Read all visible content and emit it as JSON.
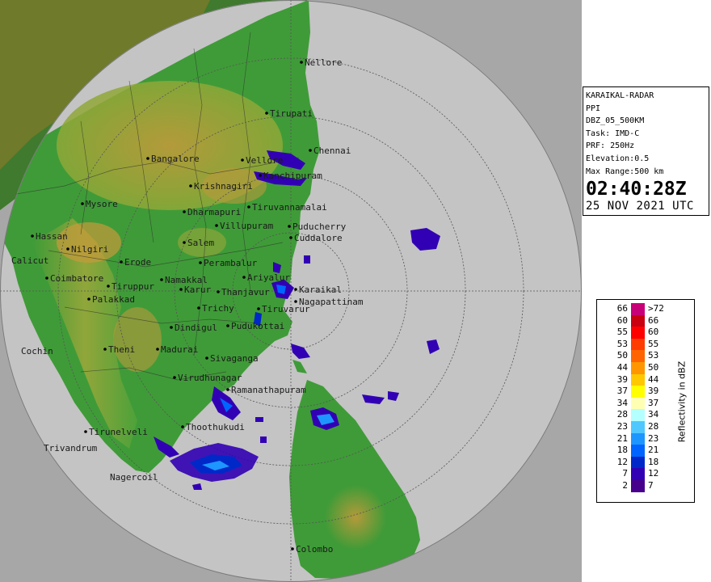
{
  "radar": {
    "station": "KARAIKAL-RADAR",
    "product": "PPI",
    "product_id": "DBZ_05_500KM",
    "task": "Task: IMD-C",
    "prf": "PRF: 250Hz",
    "elevation": "Elevation:0.5",
    "max_range": "Max Range:500 km",
    "time": "02:40:28Z",
    "date": "25 NOV 2021 UTC"
  },
  "colors": {
    "outside_range": "#a7a7a7",
    "sea": "#c4c4c4",
    "land_low": "#3f9b38",
    "land_mid": "#8ea838",
    "land_high": "#c89a3a",
    "grid": "#555555"
  },
  "cities": [
    {
      "name": "Nellore"
    },
    {
      "name": "Tirupati"
    },
    {
      "name": "Chennai"
    },
    {
      "name": "Bangalore"
    },
    {
      "name": "Vellore"
    },
    {
      "name": "Kanchipuram"
    },
    {
      "name": "Krishnagiri"
    },
    {
      "name": "Mysore"
    },
    {
      "name": "Tiruvannamalai"
    },
    {
      "name": "Dharmapuri"
    },
    {
      "name": "Villupuram"
    },
    {
      "name": "Puducherry"
    },
    {
      "name": "Cuddalore"
    },
    {
      "name": "Hassan"
    },
    {
      "name": "Nilgiri"
    },
    {
      "name": "Salem"
    },
    {
      "name": "Calicut"
    },
    {
      "name": "Erode"
    },
    {
      "name": "Perambalur"
    },
    {
      "name": "Ariyalur"
    },
    {
      "name": "Coimbatore"
    },
    {
      "name": "Tiruppur"
    },
    {
      "name": "Namakkal"
    },
    {
      "name": "Karur"
    },
    {
      "name": "Thanjavur"
    },
    {
      "name": "Karaikal"
    },
    {
      "name": "Nagapattinam"
    },
    {
      "name": "Palakkad"
    },
    {
      "name": "Trichy"
    },
    {
      "name": "Tiruvarur"
    },
    {
      "name": "Dindigul"
    },
    {
      "name": "Pudukottai"
    },
    {
      "name": "Cochin"
    },
    {
      "name": "Theni"
    },
    {
      "name": "Madurai"
    },
    {
      "name": "Sivaganga"
    },
    {
      "name": "Virudhunagar"
    },
    {
      "name": "Ramanathapuram"
    },
    {
      "name": "Thoothukudi"
    },
    {
      "name": "Tirunelveli"
    },
    {
      "name": "Trivandrum"
    },
    {
      "name": "Nagercoil"
    },
    {
      "name": "Colombo"
    }
  ],
  "legend": {
    "title": "Reflectivity in dBZ",
    "bins": [
      {
        "min": "66",
        "max": ">72",
        "color": "#c80078"
      },
      {
        "min": "60",
        "max": "66",
        "color": "#c80010"
      },
      {
        "min": "55",
        "max": "60",
        "color": "#ff0000"
      },
      {
        "min": "53",
        "max": "55",
        "color": "#ff3c00"
      },
      {
        "min": "50",
        "max": "53",
        "color": "#ff6400"
      },
      {
        "min": "44",
        "max": "50",
        "color": "#ff9600"
      },
      {
        "min": "39",
        "max": "44",
        "color": "#ffc800"
      },
      {
        "min": "37",
        "max": "39",
        "color": "#ffff00"
      },
      {
        "min": "34",
        "max": "37",
        "color": "#ffffb4"
      },
      {
        "min": "28",
        "max": "34",
        "color": "#b4ffff"
      },
      {
        "min": "23",
        "max": "28",
        "color": "#50c8ff"
      },
      {
        "min": "21",
        "max": "23",
        "color": "#1e96ff"
      },
      {
        "min": "18",
        "max": "21",
        "color": "#0064ff"
      },
      {
        "min": "12",
        "max": "18",
        "color": "#0028c8"
      },
      {
        "min": "7",
        "max": "12",
        "color": "#3200b4"
      },
      {
        "min": "2",
        "max": "7",
        "color": "#46008c"
      }
    ]
  }
}
